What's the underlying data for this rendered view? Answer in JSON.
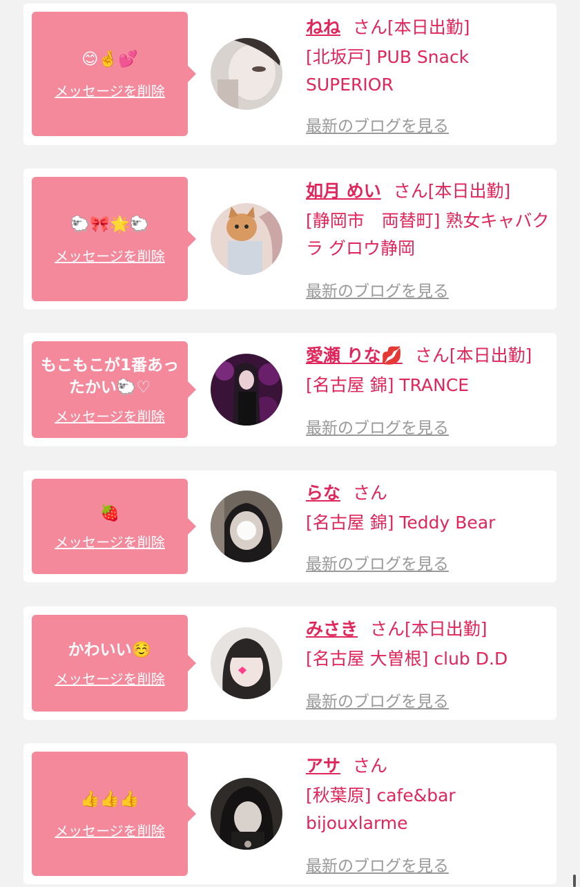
{
  "cards": [
    {
      "message": "😊🤞💕",
      "delete_label": "メッセージを削除",
      "name": "ねね",
      "honorific": "さん",
      "status": "[本日出勤]",
      "shop": "[北坂戸] PUB Snack SUPERIOR",
      "blog_label": "最新のブログを見る"
    },
    {
      "message": "🐑🎀🌟🐑",
      "delete_label": "メッセージを削除",
      "name": "如月 めい",
      "honorific": "さん",
      "status": "[本日出勤]",
      "shop": "[静岡市　両替町] 熟女キャバクラ グロウ静岡",
      "blog_label": "最新のブログを見る"
    },
    {
      "message": "もこもこが1番あったかい🐑♡",
      "delete_label": "メッセージを削除",
      "name": "愛瀬 りな💋",
      "honorific": "さん",
      "status": "[本日出勤]",
      "shop": "[名古屋 錦] TRANCE",
      "blog_label": "最新のブログを見る"
    },
    {
      "message": "🍓",
      "delete_label": "メッセージを削除",
      "name": "らな",
      "honorific": "さん",
      "status": "",
      "shop": "[名古屋 錦] Teddy Bear",
      "blog_label": "最新のブログを見る"
    },
    {
      "message": "かわいい☺️",
      "delete_label": "メッセージを削除",
      "name": "みさき",
      "honorific": "さん",
      "status": "[本日出勤]",
      "shop": "[名古屋 大曽根] club D.D",
      "blog_label": "最新のブログを見る"
    },
    {
      "message": "👍👍👍",
      "delete_label": "メッセージを削除",
      "name": "アサ",
      "honorific": "さん",
      "status": "",
      "shop": "[秋葉原] cafe&bar bijouxlarme",
      "blog_label": "最新のブログを見る"
    }
  ],
  "colors": {
    "accent": "#e0255a",
    "bubble": "#f4899c",
    "link_gray": "#999999",
    "background": "#f2f2f2"
  }
}
